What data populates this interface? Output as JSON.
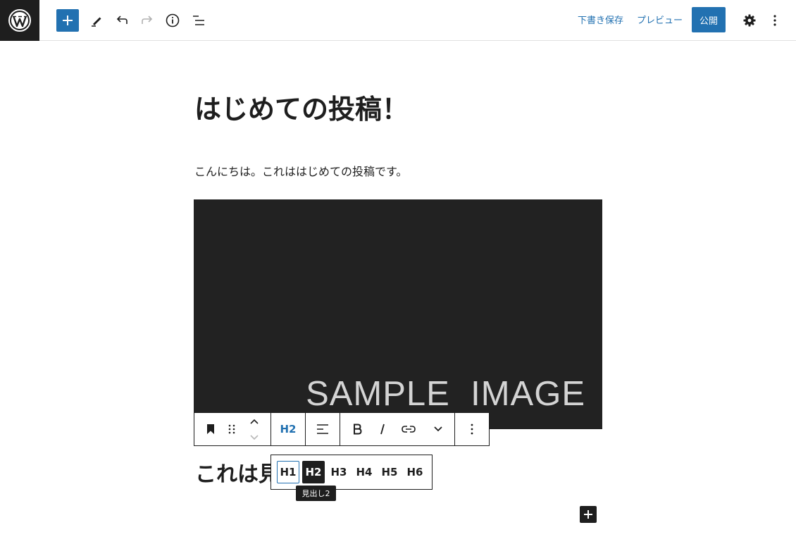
{
  "topbar": {
    "icons": {
      "logo": "wordpress-icon",
      "add": "plus-icon",
      "tools": "pencil-icon",
      "undo": "undo-icon",
      "redo": "redo-icon",
      "details": "info-icon",
      "outline": "list-view-icon",
      "settings": "gear-icon",
      "options": "vertical-ellipsis-icon"
    },
    "save_draft_label": "下書き保存",
    "preview_label": "プレビュー",
    "publish_label": "公開"
  },
  "content": {
    "post_title": "はじめての投稿！",
    "paragraph": "こんにちは。これははじめての投稿です。",
    "image_text": "SAMPLE  IMAGE",
    "heading_text": "これは見"
  },
  "block_toolbar": {
    "current_level": "H2",
    "icons": [
      "bookmark-icon",
      "drag-handle-icon",
      "move-up-icon",
      "move-down-icon",
      "align-icon",
      "bold-icon",
      "italic-icon",
      "link-icon",
      "chevron-down-icon",
      "vertical-ellipsis-icon"
    ]
  },
  "heading_levels": {
    "options": [
      "H1",
      "H2",
      "H3",
      "H4",
      "H5",
      "H6"
    ],
    "selected": "H2",
    "focused": "H1",
    "tooltip": "見出し2"
  },
  "colors": {
    "accent": "#2271b1",
    "dark": "#1e1e1e",
    "image_bg": "#222222"
  }
}
